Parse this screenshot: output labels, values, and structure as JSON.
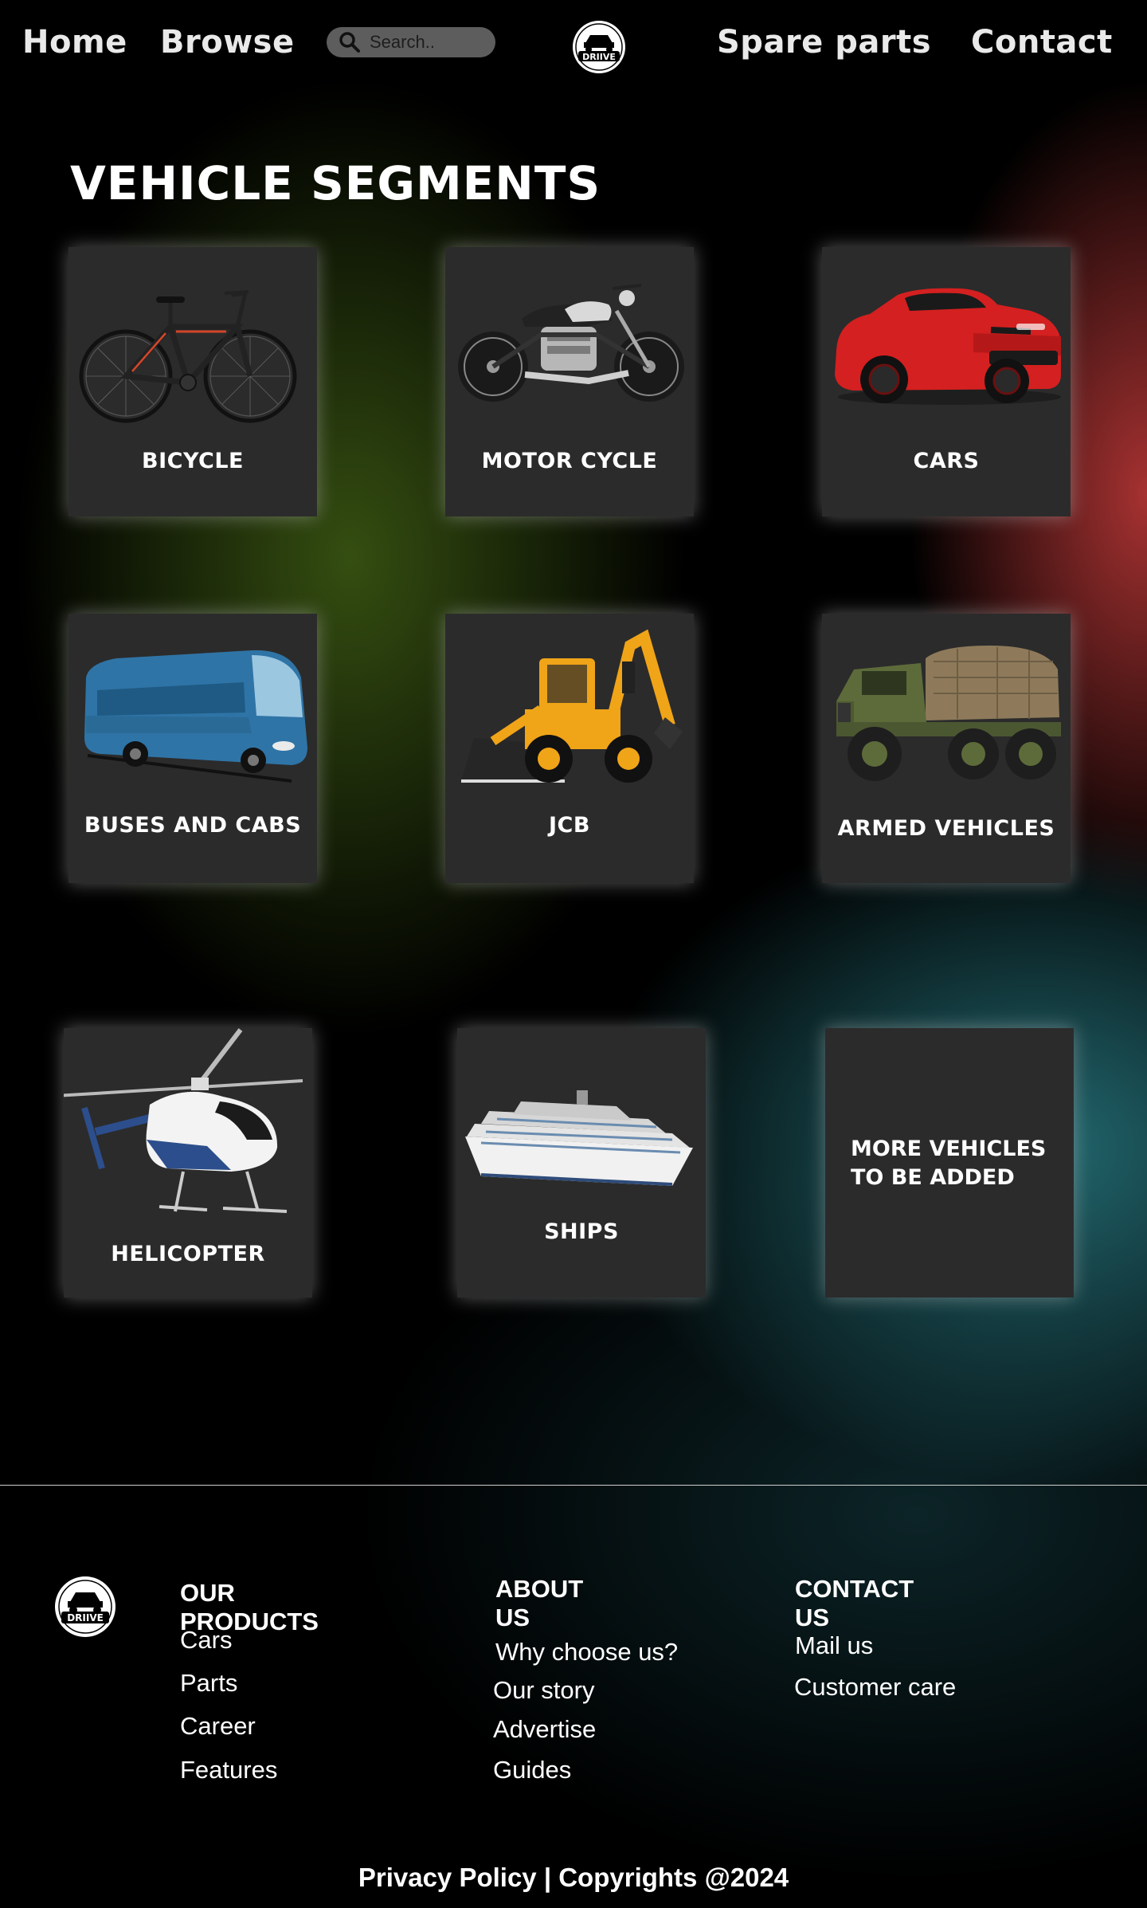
{
  "nav": {
    "home": "Home",
    "browse": "Browse",
    "search_placeholder": "Search..",
    "spare_parts": "Spare parts",
    "contact": "Contact",
    "logo_text": "DRIIVE"
  },
  "main": {
    "heading": "VEHICLE SEGMENTS",
    "cards": [
      {
        "label": "BICYCLE",
        "icon": "bicycle-image"
      },
      {
        "label": "MOTOR CYCLE",
        "icon": "motorcycle-image"
      },
      {
        "label": "CARS",
        "icon": "car-image"
      },
      {
        "label": "BUSES AND CABS",
        "icon": "bus-image"
      },
      {
        "label": "JCB",
        "icon": "jcb-image"
      },
      {
        "label": "ARMED VEHICLES",
        "icon": "armed-truck-image"
      },
      {
        "label": "HELICOPTER",
        "icon": "helicopter-image"
      },
      {
        "label": "SHIPS",
        "icon": "ship-image"
      },
      {
        "label": "MORE VEHICLES TO BE ADDED",
        "icon": ""
      }
    ]
  },
  "footer": {
    "logo_text": "DRIIVE",
    "products": {
      "heading": "OUR PRODUCTS",
      "links": [
        "Cars",
        "Parts",
        "Career",
        "Features"
      ]
    },
    "about": {
      "heading": "ABOUT US",
      "links": [
        "Why choose us?",
        "Our story",
        "Advertise",
        "Guides"
      ]
    },
    "contact": {
      "heading": "CONTACT US",
      "links": [
        "Mail us",
        "Customer care"
      ]
    },
    "copyright": "Privacy Policy | Copyrights @2024"
  },
  "colors": {
    "card_bg": "#2b2b2b",
    "red_glow": "#c43a3a",
    "green_glow": "#3e5c14",
    "teal_glow": "#26767e"
  }
}
